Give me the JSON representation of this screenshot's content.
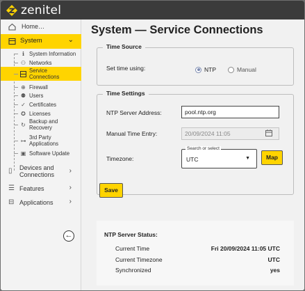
{
  "app": {
    "brand": "zenitel"
  },
  "sidebar": {
    "home": "Home…",
    "system": "System",
    "system_items": [
      {
        "label": "System Information",
        "icon": "info-icon"
      },
      {
        "label": "Networks",
        "icon": "network-icon"
      },
      {
        "label": "Service Connections",
        "icon": "service-icon",
        "active": true
      },
      {
        "label": "Firewall",
        "icon": "firewall-icon"
      },
      {
        "label": "Users",
        "icon": "users-icon"
      },
      {
        "label": "Certificates",
        "icon": "certificate-icon"
      },
      {
        "label": "Licenses",
        "icon": "license-icon"
      },
      {
        "label": "Backup and Recovery",
        "icon": "backup-icon"
      },
      {
        "label": "3rd Party Applications",
        "icon": "apps-icon"
      },
      {
        "label": "Software Update",
        "icon": "update-icon"
      }
    ],
    "groups": [
      {
        "label": "Devices and Connections"
      },
      {
        "label": "Features"
      },
      {
        "label": "Applications"
      }
    ]
  },
  "main": {
    "title": "System — Service Connections",
    "time_source": {
      "legend": "Time Source",
      "set_time_label": "Set time using:",
      "options": [
        "NTP",
        "Manual"
      ],
      "selected": "NTP"
    },
    "time_settings": {
      "legend": "Time Settings",
      "ntp_label": "NTP Server Address:",
      "ntp_value": "pool.ntp.org",
      "manual_label": "Manual Time Entry:",
      "manual_value": "20/09/2024 11:05",
      "timezone_label": "Timezone:",
      "timezone_select_label": "Search or select",
      "timezone_value": "UTC",
      "map_button": "Map"
    },
    "save_button": "Save",
    "status": {
      "title": "NTP Server Status:",
      "rows": [
        {
          "key": "Current Time",
          "value": "Fri 20/09/2024 11:05 UTC"
        },
        {
          "key": "Current Timezone",
          "value": "UTC"
        },
        {
          "key": "Synchronized",
          "value": "yes"
        }
      ]
    }
  },
  "colors": {
    "accent": "#ffd400",
    "header": "#3b3b3b",
    "radio": "#7b8ab0"
  }
}
